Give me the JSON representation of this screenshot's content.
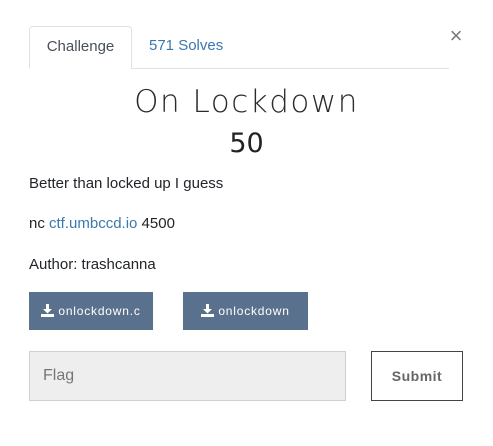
{
  "modal": {
    "close_glyph": "×"
  },
  "tabs": [
    {
      "label": "Challenge",
      "active": true
    },
    {
      "label": "571 Solves",
      "active": false
    }
  ],
  "challenge": {
    "name": "On Lockdown",
    "points": "50",
    "description": "Better than locked up I guess",
    "connection": {
      "prefix": "nc ",
      "host": "ctf.umbccd.io",
      "port": " 4500"
    },
    "author": "Author: trashcanna"
  },
  "files": [
    {
      "label": "onlockdown.c",
      "icon": "download-icon"
    },
    {
      "label": "onlockdown",
      "icon": "download-icon"
    }
  ],
  "submission": {
    "placeholder": "Flag",
    "value": "",
    "submit_label": "Submit"
  },
  "colors": {
    "link": "#3a78b0",
    "file_button": "#5a718e",
    "input_bg": "#eeeeee"
  }
}
